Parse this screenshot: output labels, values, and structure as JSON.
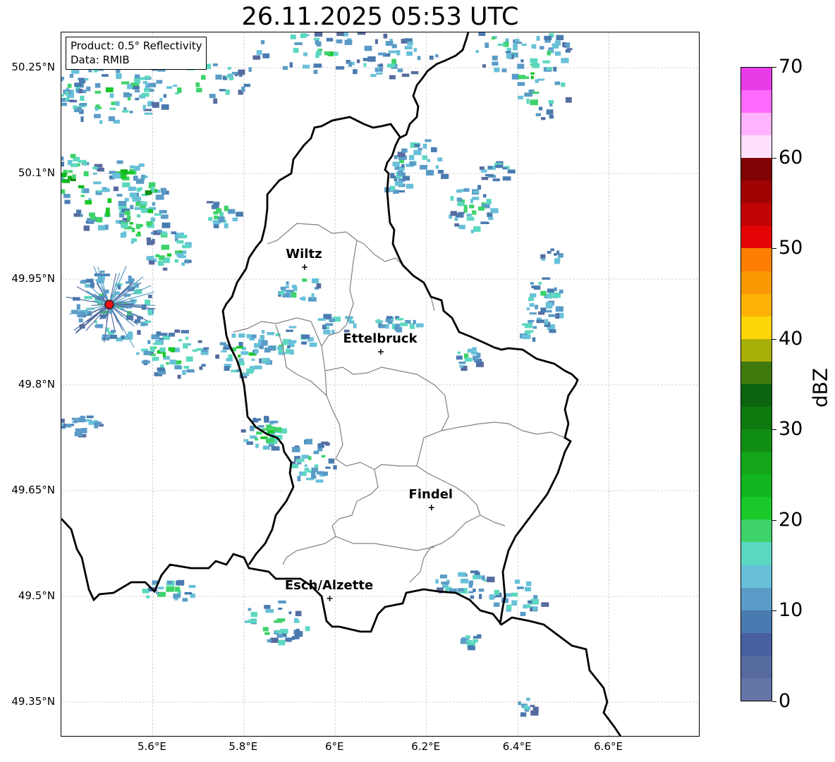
{
  "title": "26.11.2025 05:53 UTC",
  "info_box": {
    "product": "Product: 0.5° Reflectivity",
    "data": "Data: RMIB"
  },
  "axes": {
    "y_ticks": [
      "50.25°N",
      "50.1°N",
      "49.95°N",
      "49.8°N",
      "49.65°N",
      "49.5°N",
      "49.35°N"
    ],
    "x_ticks": [
      "5.6°E",
      "5.8°E",
      "6°E",
      "6.2°E",
      "6.4°E",
      "6.6°E"
    ],
    "lat_range": [
      49.3,
      50.3
    ],
    "lon_range": [
      5.4,
      6.8
    ],
    "grid": true
  },
  "cities": [
    {
      "name": "Wiltz",
      "lon": 5.933,
      "lat": 49.967
    },
    {
      "name": "Ettelbruck",
      "lon": 6.1,
      "lat": 49.847
    },
    {
      "name": "Findel",
      "lon": 6.211,
      "lat": 49.626
    },
    {
      "name": "Esch/Alzette",
      "lon": 5.988,
      "lat": 49.497
    }
  ],
  "radar_site": {
    "lon": 5.505,
    "lat": 49.914
  },
  "colorbar": {
    "label": "dBZ",
    "range": [
      0,
      70
    ],
    "tick_labels": [
      "0",
      "10",
      "20",
      "30",
      "40",
      "50",
      "60",
      "70"
    ],
    "colors": [
      "#6475a8",
      "#566b9f",
      "#4860a2",
      "#4a7bb0",
      "#5a9bc7",
      "#68c0d9",
      "#5dd8c0",
      "#3ed36a",
      "#19c829",
      "#12b51d",
      "#14a518",
      "#108e13",
      "#0d7a10",
      "#0a6410",
      "#3f7a0c",
      "#a8ae08",
      "#fed506",
      "#fcb306",
      "#fb9904",
      "#fd7e03",
      "#e30304",
      "#c00303",
      "#9f0303",
      "#7f0303",
      "#ffe0ff",
      "#ffb3ff",
      "#ff6bff",
      "#e93ce9"
    ]
  },
  "colors": {
    "border_national": "#000000",
    "border_canton": "#808080",
    "grid": "#c8c8c8",
    "radar_marker": "#ee1111"
  }
}
